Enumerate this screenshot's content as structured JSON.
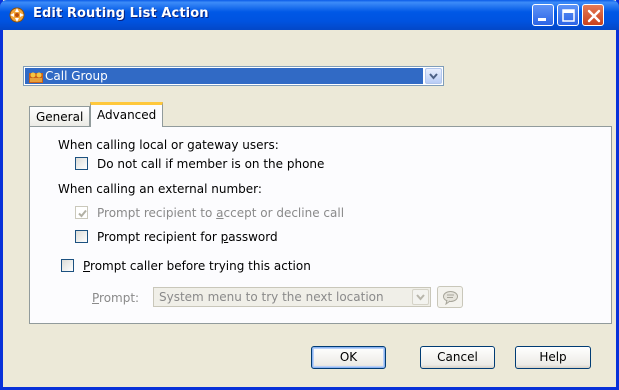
{
  "window": {
    "title": "Edit Routing List Action"
  },
  "action_select": {
    "value": "Call Group"
  },
  "tabs": [
    {
      "label": "General"
    },
    {
      "label": "Advanced"
    }
  ],
  "advanced": {
    "local_heading": "When calling local or gateway users:",
    "do_not_call": {
      "label": "Do not call if member is on the phone",
      "checked": false
    },
    "external_heading": "When calling an external number:",
    "prompt_accept": {
      "label_pre": "Prompt recipient to ",
      "label_accel": "a",
      "label_post": "ccept or decline call",
      "checked": true,
      "enabled": false
    },
    "prompt_password": {
      "label_pre": "Prompt recipient for ",
      "label_accel": "p",
      "label_post": "assword",
      "checked": false
    },
    "prompt_caller": {
      "label_accel": "P",
      "label_post": "rompt caller before trying this action",
      "checked": false
    },
    "prompt_label_accel": "P",
    "prompt_label_post": "rompt:",
    "prompt_value": "System menu to try the next location"
  },
  "buttons": {
    "ok": "OK",
    "cancel": "Cancel",
    "help": "Help"
  }
}
